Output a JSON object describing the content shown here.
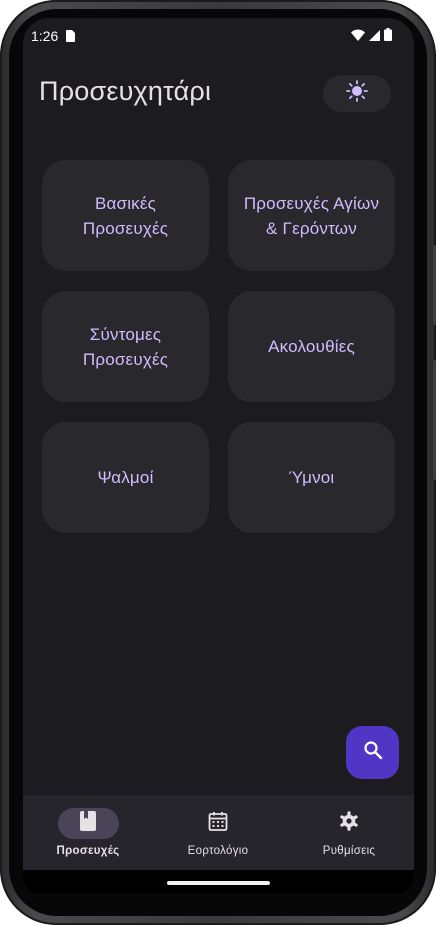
{
  "colors": {
    "background": "#1c1b1f",
    "card": "#29282d",
    "accent_text": "#d0bcff",
    "fab": "#4f36c4",
    "nav_bar": "#27252c",
    "nav_active_pill": "#4a4458"
  },
  "status_bar": {
    "time": "1:26",
    "icons": [
      "sim-card-icon",
      "wifi-icon",
      "signal-icon",
      "battery-icon"
    ]
  },
  "header": {
    "title": "Προσευχητάρι",
    "theme_toggle_icon": "sun-icon"
  },
  "categories": [
    {
      "label": "Βασικές Προσευχές"
    },
    {
      "label": "Προσευχές Αγίων & Γερόντων"
    },
    {
      "label": "Σύντομες Προσευχές"
    },
    {
      "label": "Ακολουθίες"
    },
    {
      "label": "Ψαλμοί"
    },
    {
      "label": "Ύμνοι"
    }
  ],
  "fab": {
    "icon": "search-icon"
  },
  "bottom_nav": {
    "items": [
      {
        "label": "Προσευχές",
        "icon": "book-icon",
        "active": true
      },
      {
        "label": "Εορτολόγιο",
        "icon": "calendar-icon",
        "active": false
      },
      {
        "label": "Ρυθμίσεις",
        "icon": "gear-icon",
        "active": false
      }
    ]
  }
}
